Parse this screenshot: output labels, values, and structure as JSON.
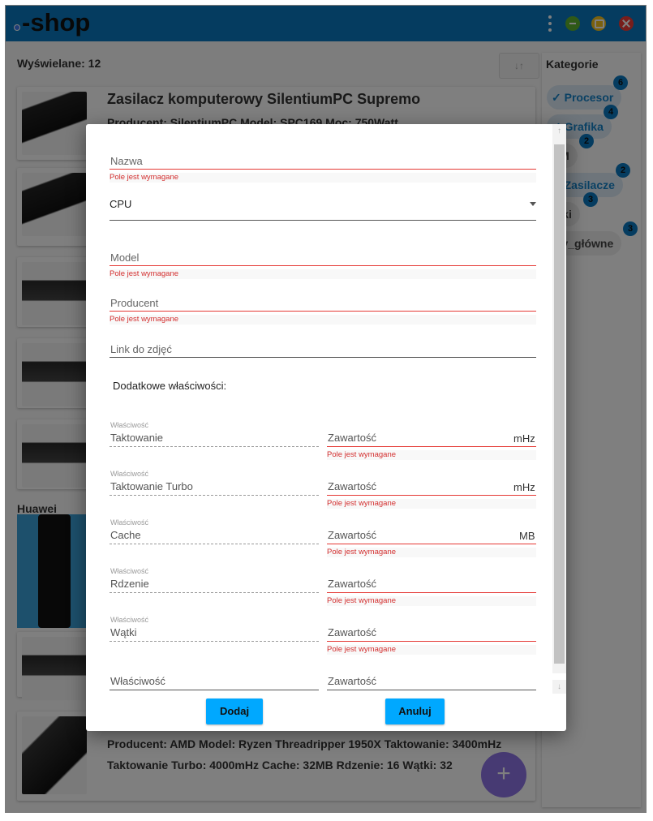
{
  "app": {
    "logo": "-shop"
  },
  "list": {
    "count_label": "Wyświelane: 12",
    "sort_label": "↓↑",
    "section_title": "Huawei",
    "cards": [
      {
        "title": "Zasilacz komputerowy SilentiumPC Supremo",
        "details": "Producent: SilentiumPC  Model: SPC169  Moc: 750Watt"
      },
      {
        "details_line1": "Producent: AMD  Model: Ryzen Threadripper 1950X  Taktowanie: 3400mHz",
        "details_line2": "Taktowanie Turbo: 4000mHz  Cache: 32MB  Rdzenie: 16  Wątki: 32"
      }
    ],
    "fab_label": "+"
  },
  "sidebar": {
    "title": "Kategorie",
    "chips": [
      {
        "label": "Procesor",
        "count": "6",
        "selected": true
      },
      {
        "label": "Grafika",
        "count": "4",
        "selected": true
      },
      {
        "label": "AM",
        "count": "2",
        "selected": false
      },
      {
        "label": "Zasilacze",
        "count": "2",
        "selected": true
      },
      {
        "label": "rski",
        "count": "3",
        "selected": false
      },
      {
        "label": "yty_główne",
        "count": "3",
        "selected": false
      }
    ]
  },
  "dialog": {
    "name_label": "Nazwa",
    "required_error": "Pole jest wymagane",
    "category_value": "CPU",
    "model_label": "Model",
    "producer_label": "Producent",
    "image_link_label": "Link do zdjęć",
    "extra_props_heading": "Dodatkowe właściwości:",
    "property_caption": "Właściwość",
    "value_label": "Zawartość",
    "properties": [
      {
        "name": "Taktowanie",
        "unit": "mHz"
      },
      {
        "name": "Taktowanie Turbo",
        "unit": "mHz"
      },
      {
        "name": "Cache",
        "unit": "MB"
      },
      {
        "name": "Rdzenie",
        "unit": ""
      },
      {
        "name": "Wątki",
        "unit": ""
      }
    ],
    "new_property_placeholder": "Właściwość",
    "new_value_placeholder": "Zawartość",
    "add_button": "Dodaj",
    "cancel_button": "Anuluj"
  }
}
